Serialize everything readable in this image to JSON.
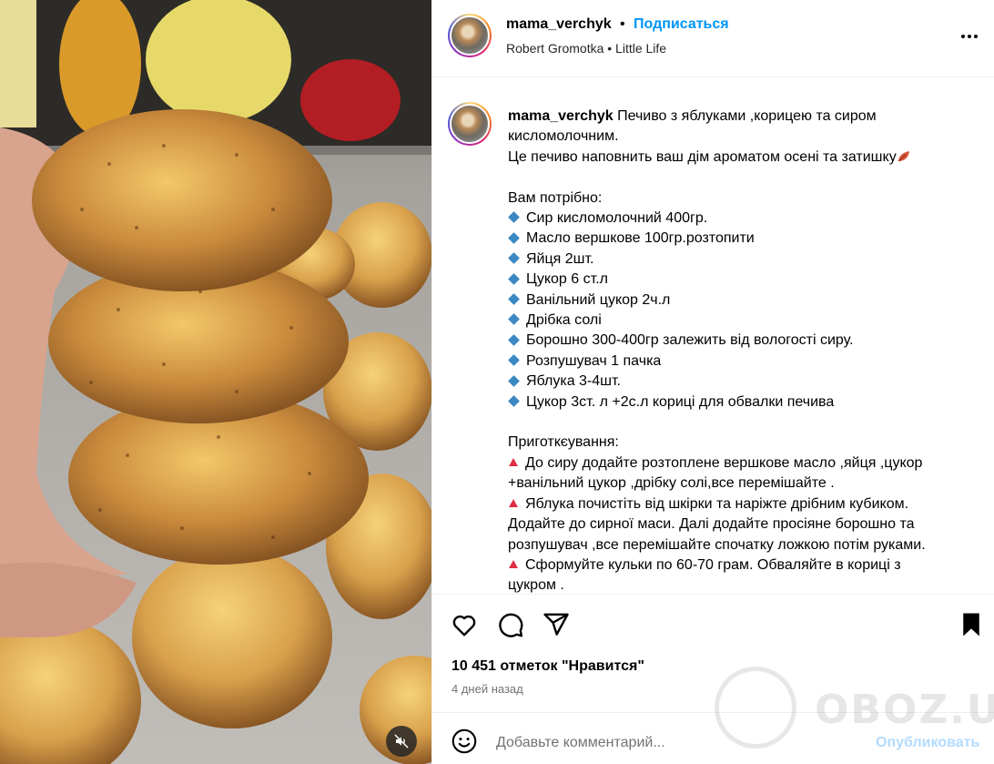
{
  "post": {
    "username": "mama_verchyk",
    "separator": "•",
    "follow_label": "Подписаться",
    "audio": "Robert Gromotka • Little Life"
  },
  "caption": {
    "username": "mama_verchyk",
    "title_line_1": " Печиво з яблуками ,корицею та сиром",
    "title_line_2": "кисломолочним.",
    "intro": "Це печиво наповнить ваш дім ароматом осені та затишку",
    "ingredients_heading": "Вам потрібно:",
    "ingredients": [
      "Сир кисломолочний 400гр.",
      "Масло вершкове 100гр.розтопити",
      "Яйця 2шт.",
      "Цукор 6 ст.л",
      "Ванільний цукор 2ч.л",
      "Дрібка солі",
      "Борошно 300-400гр залежить від вологості сиру.",
      "Розпушувач 1 пачка",
      "Яблука 3-4шт.",
      "Цукор 3ст. л +2с.л кориці для обвалки печива"
    ],
    "method_heading": "Приготкєування:",
    "method_lines": [
      {
        "marker": true,
        "text": "До сиру додайте розтоплене вершкове масло ,яйця ,цукор"
      },
      {
        "marker": false,
        "text": "+ванільний цукор ,дрібку солі,все перемішайте ."
      },
      {
        "marker": true,
        "text": "Яблука почистіть від шкірки та наріжте дрібним кубиком."
      },
      {
        "marker": false,
        "text": "Додайте до сирної маси. Далі додайте просіяне борошно та"
      },
      {
        "marker": false,
        "text": "розпушувач ,все перемішайте спочатку ложкою потім руками."
      },
      {
        "marker": true,
        "text": "Сформуйте кульки по 60-70 грам. Обваляйте в кориці з"
      },
      {
        "marker": false,
        "text": "цукром ."
      }
    ]
  },
  "engagement": {
    "likes": "10 451 отметок \"Нравится\"",
    "time": "4 дней назад"
  },
  "comment": {
    "placeholder": "Добавьте комментарий...",
    "publish_label": "Опубликовать"
  },
  "watermark": "OBOZ.UA",
  "icons": {
    "like": "heart-icon",
    "comment": "comment-icon",
    "share": "share-icon",
    "save": "bookmark-icon",
    "emoji": "emoji-icon",
    "more": "more-icon",
    "mute": "muted-speaker-icon"
  },
  "colors": {
    "accent": "#0095f6",
    "publish_disabled": "#b3dbff",
    "muted_text": "#737373",
    "bullet_diamond": "#3b88c3",
    "bullet_triangle": "#dd2e44"
  }
}
